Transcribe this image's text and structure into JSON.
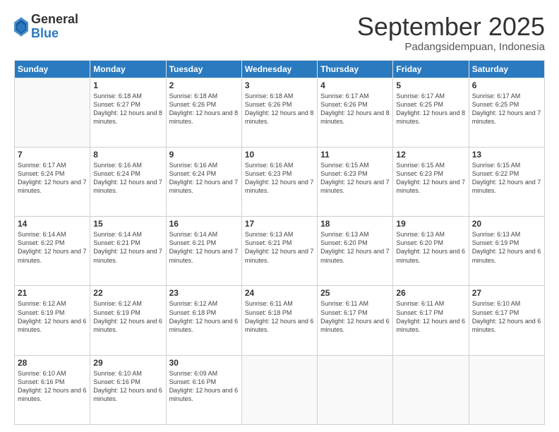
{
  "logo": {
    "general": "General",
    "blue": "Blue"
  },
  "header": {
    "month": "September 2025",
    "location": "Padangsidempuan, Indonesia"
  },
  "weekdays": [
    "Sunday",
    "Monday",
    "Tuesday",
    "Wednesday",
    "Thursday",
    "Friday",
    "Saturday"
  ],
  "weeks": [
    [
      {
        "day": "",
        "info": ""
      },
      {
        "day": "1",
        "info": "Sunrise: 6:18 AM\nSunset: 6:27 PM\nDaylight: 12 hours\nand 8 minutes."
      },
      {
        "day": "2",
        "info": "Sunrise: 6:18 AM\nSunset: 6:26 PM\nDaylight: 12 hours\nand 8 minutes."
      },
      {
        "day": "3",
        "info": "Sunrise: 6:18 AM\nSunset: 6:26 PM\nDaylight: 12 hours\nand 8 minutes."
      },
      {
        "day": "4",
        "info": "Sunrise: 6:17 AM\nSunset: 6:26 PM\nDaylight: 12 hours\nand 8 minutes."
      },
      {
        "day": "5",
        "info": "Sunrise: 6:17 AM\nSunset: 6:25 PM\nDaylight: 12 hours\nand 8 minutes."
      },
      {
        "day": "6",
        "info": "Sunrise: 6:17 AM\nSunset: 6:25 PM\nDaylight: 12 hours\nand 7 minutes."
      }
    ],
    [
      {
        "day": "7",
        "info": "Sunrise: 6:17 AM\nSunset: 6:24 PM\nDaylight: 12 hours\nand 7 minutes."
      },
      {
        "day": "8",
        "info": "Sunrise: 6:16 AM\nSunset: 6:24 PM\nDaylight: 12 hours\nand 7 minutes."
      },
      {
        "day": "9",
        "info": "Sunrise: 6:16 AM\nSunset: 6:24 PM\nDaylight: 12 hours\nand 7 minutes."
      },
      {
        "day": "10",
        "info": "Sunrise: 6:16 AM\nSunset: 6:23 PM\nDaylight: 12 hours\nand 7 minutes."
      },
      {
        "day": "11",
        "info": "Sunrise: 6:15 AM\nSunset: 6:23 PM\nDaylight: 12 hours\nand 7 minutes."
      },
      {
        "day": "12",
        "info": "Sunrise: 6:15 AM\nSunset: 6:23 PM\nDaylight: 12 hours\nand 7 minutes."
      },
      {
        "day": "13",
        "info": "Sunrise: 6:15 AM\nSunset: 6:22 PM\nDaylight: 12 hours\nand 7 minutes."
      }
    ],
    [
      {
        "day": "14",
        "info": "Sunrise: 6:14 AM\nSunset: 6:22 PM\nDaylight: 12 hours\nand 7 minutes."
      },
      {
        "day": "15",
        "info": "Sunrise: 6:14 AM\nSunset: 6:21 PM\nDaylight: 12 hours\nand 7 minutes."
      },
      {
        "day": "16",
        "info": "Sunrise: 6:14 AM\nSunset: 6:21 PM\nDaylight: 12 hours\nand 7 minutes."
      },
      {
        "day": "17",
        "info": "Sunrise: 6:13 AM\nSunset: 6:21 PM\nDaylight: 12 hours\nand 7 minutes."
      },
      {
        "day": "18",
        "info": "Sunrise: 6:13 AM\nSunset: 6:20 PM\nDaylight: 12 hours\nand 7 minutes."
      },
      {
        "day": "19",
        "info": "Sunrise: 6:13 AM\nSunset: 6:20 PM\nDaylight: 12 hours\nand 6 minutes."
      },
      {
        "day": "20",
        "info": "Sunrise: 6:13 AM\nSunset: 6:19 PM\nDaylight: 12 hours\nand 6 minutes."
      }
    ],
    [
      {
        "day": "21",
        "info": "Sunrise: 6:12 AM\nSunset: 6:19 PM\nDaylight: 12 hours\nand 6 minutes."
      },
      {
        "day": "22",
        "info": "Sunrise: 6:12 AM\nSunset: 6:19 PM\nDaylight: 12 hours\nand 6 minutes."
      },
      {
        "day": "23",
        "info": "Sunrise: 6:12 AM\nSunset: 6:18 PM\nDaylight: 12 hours\nand 6 minutes."
      },
      {
        "day": "24",
        "info": "Sunrise: 6:11 AM\nSunset: 6:18 PM\nDaylight: 12 hours\nand 6 minutes."
      },
      {
        "day": "25",
        "info": "Sunrise: 6:11 AM\nSunset: 6:17 PM\nDaylight: 12 hours\nand 6 minutes."
      },
      {
        "day": "26",
        "info": "Sunrise: 6:11 AM\nSunset: 6:17 PM\nDaylight: 12 hours\nand 6 minutes."
      },
      {
        "day": "27",
        "info": "Sunrise: 6:10 AM\nSunset: 6:17 PM\nDaylight: 12 hours\nand 6 minutes."
      }
    ],
    [
      {
        "day": "28",
        "info": "Sunrise: 6:10 AM\nSunset: 6:16 PM\nDaylight: 12 hours\nand 6 minutes."
      },
      {
        "day": "29",
        "info": "Sunrise: 6:10 AM\nSunset: 6:16 PM\nDaylight: 12 hours\nand 6 minutes."
      },
      {
        "day": "30",
        "info": "Sunrise: 6:09 AM\nSunset: 6:16 PM\nDaylight: 12 hours\nand 6 minutes."
      },
      {
        "day": "",
        "info": ""
      },
      {
        "day": "",
        "info": ""
      },
      {
        "day": "",
        "info": ""
      },
      {
        "day": "",
        "info": ""
      }
    ]
  ]
}
